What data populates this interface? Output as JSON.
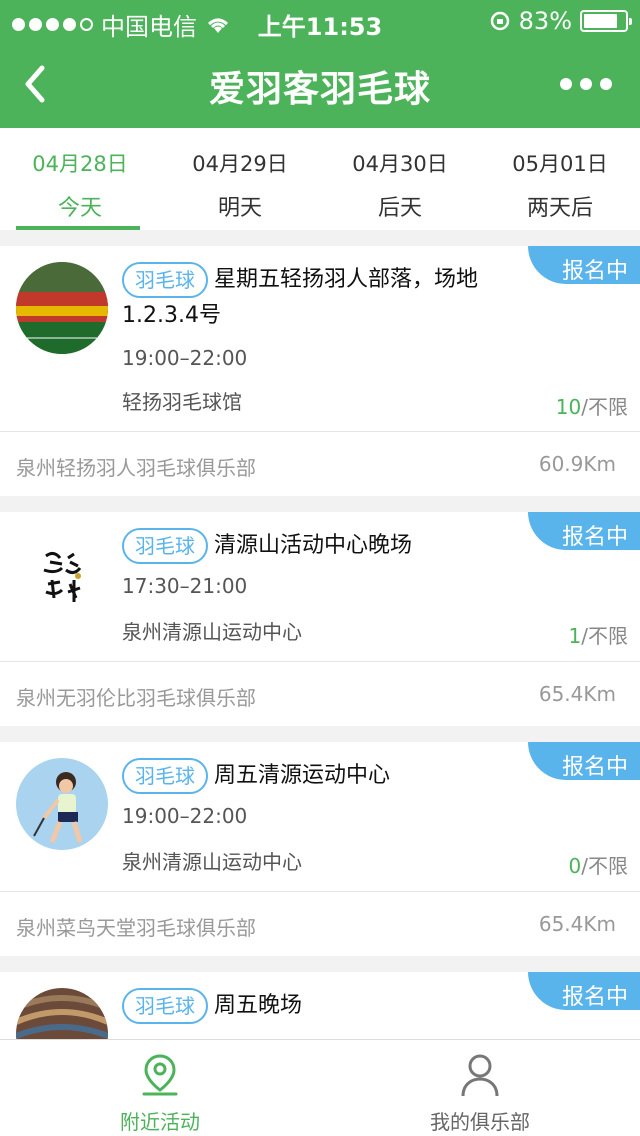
{
  "status_bar": {
    "carrier": "中国电信",
    "time": "上午11:53",
    "battery": "83%",
    "battery_level": 0.83
  },
  "nav": {
    "title": "爱羽客羽毛球"
  },
  "date_tabs": [
    {
      "date": "04月28日",
      "label": "今天",
      "active": true
    },
    {
      "date": "04月29日",
      "label": "明天",
      "active": false
    },
    {
      "date": "04月30日",
      "label": "后天",
      "active": false
    },
    {
      "date": "05月01日",
      "label": "两天后",
      "active": false
    }
  ],
  "activities": [
    {
      "tag": "羽毛球",
      "title": "星期五轻扬羽人部落，场地1.2.3.4号",
      "time": "19:00–22:00",
      "venue": "轻扬羽毛球馆",
      "joined": "10",
      "limit": "/不限",
      "status": "报名中",
      "club": "泉州轻扬羽人羽毛球俱乐部",
      "distance": "60.9Km"
    },
    {
      "tag": "羽毛球",
      "title": "清源山活动中心晚场",
      "time": "17:30–21:00",
      "venue": "泉州清源山运动中心",
      "joined": "1",
      "limit": "/不限",
      "status": "报名中",
      "club": "泉州无羽伦比羽毛球俱乐部",
      "distance": "65.4Km"
    },
    {
      "tag": "羽毛球",
      "title": "周五清源运动中心",
      "time": "19:00–22:00",
      "venue": "泉州清源山运动中心",
      "joined": "0",
      "limit": "/不限",
      "status": "报名中",
      "club": "泉州菜鸟天堂羽毛球俱乐部",
      "distance": "65.4Km"
    },
    {
      "tag": "羽毛球",
      "title": "周五晚场",
      "status": "报名中"
    }
  ],
  "bottom_nav": [
    {
      "label": "附近活动",
      "icon": "location-pin-icon",
      "active": true
    },
    {
      "label": "我的俱乐部",
      "icon": "person-icon",
      "active": false
    }
  ],
  "colors": {
    "primary": "#4cb35a",
    "badge": "#5ab4ec"
  }
}
